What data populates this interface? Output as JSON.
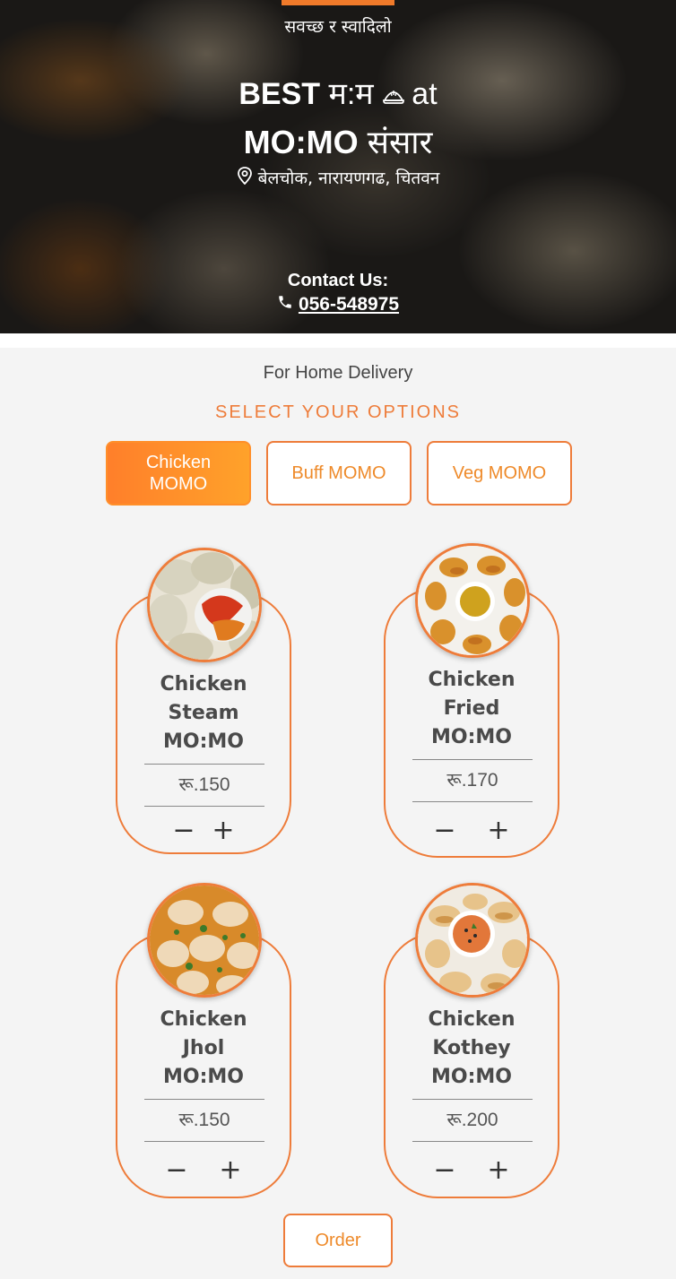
{
  "hero": {
    "tagline": "सवच्छ र स्वादिलो",
    "title_best": "BEST",
    "title_momo_np": "म:म",
    "title_momo_icon": "🥟",
    "title_at": "at",
    "title_brand": "MO:MO",
    "title_sansar": "संसार",
    "location": "बेलचोक, नारायणगढ, चितवन",
    "contact_label": "Contact Us:",
    "phone": "056-548975"
  },
  "delivery_text": "For Home Delivery",
  "select_options_text": "SELECT YOUR OPTIONS",
  "tabs": [
    {
      "label": "Chicken MOMO",
      "active": true
    },
    {
      "label": "Buff MOMO",
      "active": false
    },
    {
      "label": "Veg MOMO",
      "active": false
    }
  ],
  "products": [
    {
      "name_line1": "Chicken",
      "name_line2": "Steam",
      "name_line3": "MO:MO",
      "price": "रू.150",
      "minus": "−",
      "plus": "+"
    },
    {
      "name_line1": "Chicken",
      "name_line2": "Fried",
      "name_line3": "MO:MO",
      "price": "रू.170",
      "minus": "−",
      "plus": "+"
    },
    {
      "name_line1": "Chicken",
      "name_line2": "Jhol",
      "name_line3": "MO:MO",
      "price": "रू.150",
      "minus": "−",
      "plus": "+"
    },
    {
      "name_line1": "Chicken",
      "name_line2": "Kothey",
      "name_line3": "MO:MO",
      "price": "रू.200",
      "minus": "−",
      "plus": "+"
    }
  ],
  "order_button": "Order",
  "colors": {
    "accent": "#ee7c3a",
    "accent_gradient_start": "#ff7f2a",
    "accent_gradient_end": "#ffa22a",
    "background": "#f4f4f4"
  },
  "icons": {
    "location": "map-pin-icon",
    "phone": "phone-icon",
    "dumpling": "dumpling-icon"
  }
}
